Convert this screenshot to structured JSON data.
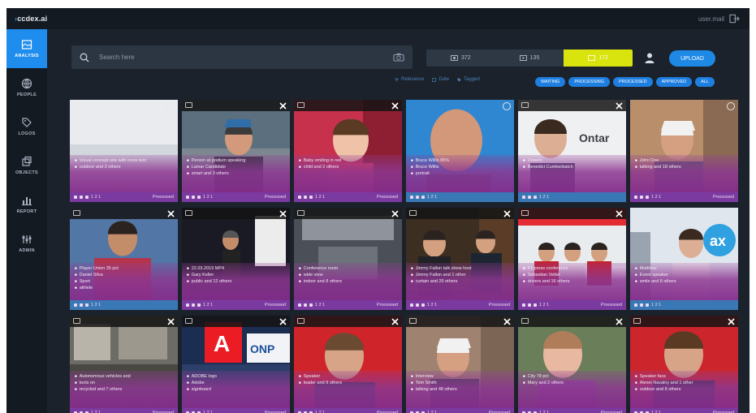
{
  "header": {
    "logo_text": "ccdex.ai",
    "user_label": "user.mail"
  },
  "sidebar": {
    "items": [
      {
        "label": "ANALYSIS",
        "icon": "image-gallery-icon",
        "active": true
      },
      {
        "label": "PEOPLE",
        "icon": "globe-icon",
        "active": false
      },
      {
        "label": "LOGOS",
        "icon": "tag-icon",
        "active": false
      },
      {
        "label": "OBJECTS",
        "icon": "objects-icon",
        "active": false
      },
      {
        "label": "REPORT",
        "icon": "bar-chart-icon",
        "active": false
      },
      {
        "label": "ADMIN",
        "icon": "admin-icon",
        "active": false
      }
    ]
  },
  "search": {
    "placeholder": "Search here"
  },
  "media_filter": [
    {
      "label": "372",
      "icon": "image-icon",
      "active": false
    },
    {
      "label": "135",
      "icon": "video-icon",
      "active": false
    },
    {
      "label": "172",
      "icon": "audio-icon",
      "active": true
    }
  ],
  "upload_label": "UPLOAD",
  "sort_options": [
    "Relevance",
    "Date",
    "Tagged"
  ],
  "status_chips": [
    "WAITING",
    "PROCESSING",
    "PROCESSED",
    "APPROVED",
    "ALL"
  ],
  "cards": [
    {
      "lines": [
        "Visual concept one with more text",
        "outdoor and 3 others"
      ],
      "footer_left": "1 2 1",
      "footer_right": "Processed",
      "scene": "sky",
      "footer_color": "purple"
    },
    {
      "lines": [
        "Person at podium speaking",
        "Lamar Candidate",
        "smart and 3 others"
      ],
      "footer_left": "1 2 1",
      "footer_right": "Processed",
      "scene": "man-cap",
      "footer_color": "purple"
    },
    {
      "lines": [
        "Baby smiling in red",
        "child and 2 others"
      ],
      "footer_left": "1 2 1",
      "footer_right": "Processed",
      "scene": "baby",
      "footer_color": "purple"
    },
    {
      "lines": [
        "Bruce Willis 95%",
        "Bruce Willis",
        "portrait"
      ],
      "footer_left": "1 2 1",
      "footer_right": "",
      "scene": "bald-blue",
      "footer_color": "blue"
    },
    {
      "lines": [
        "Ontario",
        "Benedict Cumberbatch"
      ],
      "footer_left": "1 2 1",
      "footer_right": "",
      "scene": "benedict",
      "footer_color": "blue"
    },
    {
      "lines": [
        "John Doe",
        "talking and 18 others"
      ],
      "footer_left": "1 2 1",
      "footer_right": "Processed",
      "scene": "street-cap",
      "footer_color": "purple"
    },
    {
      "lines": [
        "Player Union 35 pct",
        "Daniel Silva",
        "Sport",
        "athlete"
      ],
      "footer_left": "1 2 1",
      "footer_right": "",
      "scene": "footballer",
      "footer_color": "blue"
    },
    {
      "lines": [
        "22.03.2019 MP4",
        "Gary Keller",
        "public and 12 others"
      ],
      "footer_left": "1 2 1",
      "footer_right": "Processed",
      "scene": "stage",
      "footer_color": "purple"
    },
    {
      "lines": [
        "Conference room",
        "wide view",
        "indoor and 8 others"
      ],
      "footer_left": "1 2 1",
      "footer_right": "Processed",
      "scene": "hall",
      "footer_color": "purple"
    },
    {
      "lines": [
        "Jimmy Fallon talk show host",
        "Jimmy Fallon and 1 other",
        "curtain and 20 others"
      ],
      "footer_left": "1 2 1",
      "footer_right": "Processed",
      "scene": "talkshow",
      "footer_color": "purple"
    },
    {
      "lines": [
        "F1 press conference",
        "Sebastian Vettel",
        "drivers and 16 others"
      ],
      "footer_left": "1 2 1",
      "footer_right": "Processed",
      "scene": "f1",
      "footer_color": "purple"
    },
    {
      "lines": [
        "Matthew",
        "Event speaker",
        "smile and 8 others"
      ],
      "footer_left": "1 2 1",
      "footer_right": "",
      "scene": "ax",
      "footer_color": "blue"
    },
    {
      "lines": [
        "Autonomous vehicles and",
        "tools on",
        "recycled and 7 others"
      ],
      "footer_left": "1 2 1",
      "footer_right": "Processed",
      "scene": "lab",
      "footer_color": "purple"
    },
    {
      "lines": [
        "ADOBE logo",
        "Adobe",
        "signboard"
      ],
      "footer_left": "1 2 1",
      "footer_right": "Processed",
      "scene": "adobe",
      "footer_color": "purple"
    },
    {
      "lines": [
        "Speaker",
        "leader and 9 others"
      ],
      "footer_left": "1 2 1",
      "footer_right": "Processed",
      "scene": "man-red",
      "footer_color": "purple"
    },
    {
      "lines": [
        "Interview",
        "Tom Smith",
        "talking and 48 others"
      ],
      "footer_left": "1 2 1",
      "footer_right": "Processed",
      "scene": "street-cap2",
      "footer_color": "purple"
    },
    {
      "lines": [
        "City 78 pct",
        "Mary and 2 others"
      ],
      "footer_left": "1 2 1",
      "footer_right": "Processed",
      "scene": "woman",
      "footer_color": "purple"
    },
    {
      "lines": [
        "Speaker face",
        "Alexei Navalny and 1 other",
        "outdoor and 8 others"
      ],
      "footer_left": "1 2 1",
      "footer_right": "Processed",
      "scene": "man-red2",
      "footer_color": "purple"
    }
  ]
}
